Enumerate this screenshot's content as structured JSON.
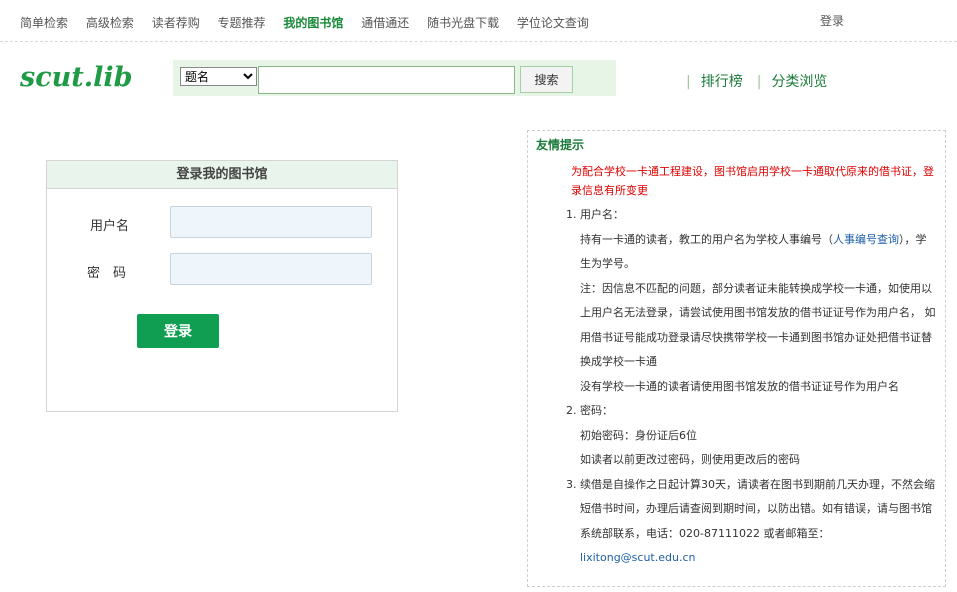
{
  "nav": {
    "items": [
      "简单检索",
      "高级检索",
      "读者荐购",
      "专题推荐",
      "我的图书馆",
      "通借通还",
      "随书光盘下载",
      "学位论文查询"
    ],
    "active_index": 4,
    "login": "登录"
  },
  "logo": "scut.lib",
  "search": {
    "field_selected": "题名",
    "query": "",
    "button": "搜索"
  },
  "quick_links": [
    "排行榜",
    "分类浏览"
  ],
  "login_box": {
    "title": "登录我的图书馆",
    "username_label": "用户名",
    "password_label": "密　码",
    "username_value": "",
    "password_value": "",
    "submit": "登录"
  },
  "tips": {
    "title": "友情提示",
    "notice": "为配合学校一卡通工程建设，图书馆启用学校一卡通取代原来的借书证，登录信息有所变更",
    "item1_title": "用户名：",
    "item1_p1_a": "持有一卡通的读者，教工的用户名为学校人事编号（",
    "item1_p1_link": "人事编号查询",
    "item1_p1_b": "），学生为学号。",
    "item1_p2": "注：因信息不匹配的问题，部分读者证未能转换成学校一卡通，如使用以上用户名无法登录，请尝试使用图书馆发放的借书证证号作为用户名， 如用借书证号能成功登录请尽快携带学校一卡通到图书馆办证处把借书证替换成学校一卡通",
    "item1_p3": "没有学校一卡通的读者请使用图书馆发放的借书证证号作为用户名",
    "item2_title": "密码：",
    "item2_p1": "初始密码：身份证后6位",
    "item2_p2": "如读者以前更改过密码，则使用更改后的密码",
    "item3_text": "续借是自操作之日起计算30天，请读者在图书到期前几天办理，不然会缩短借书时间，办理后请查阅到期时间，以防出错。如有错误，请与图书馆系统部联系，电话：020-87111022 或者邮箱至：",
    "item3_email": "lixitong@scut.edu.cn"
  },
  "colors": {
    "brand_green": "#1f9a46",
    "button_green": "#0f9e52",
    "notice_red": "#e00000",
    "link_blue": "#1f5fa8"
  }
}
